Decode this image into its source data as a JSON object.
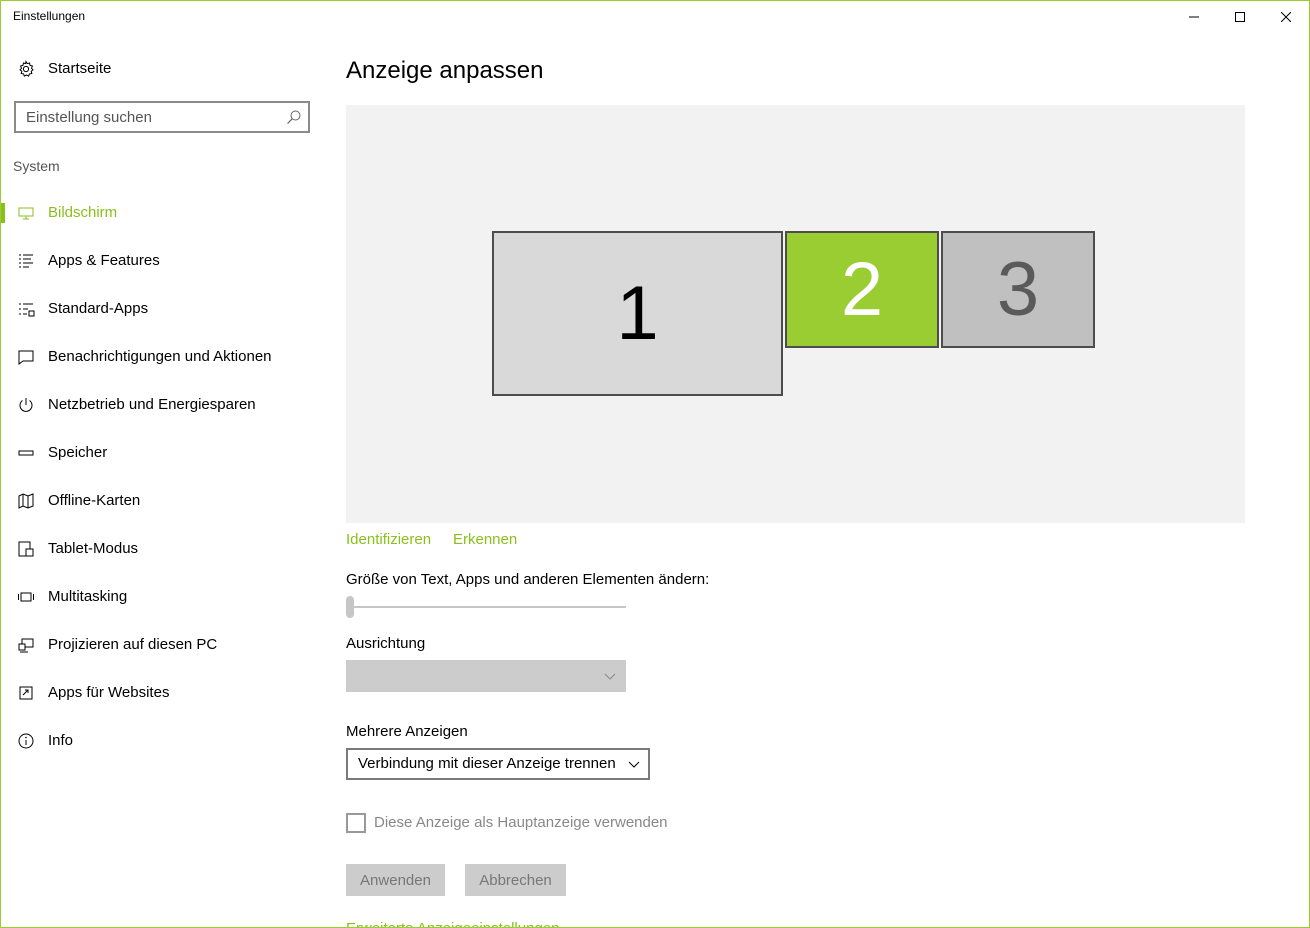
{
  "window": {
    "title": "Einstellungen"
  },
  "sidebar": {
    "home_label": "Startseite",
    "search_placeholder": "Einstellung suchen",
    "section_title": "System",
    "items": [
      {
        "label": "Bildschirm",
        "icon": "monitor-icon",
        "active": true
      },
      {
        "label": "Apps & Features",
        "icon": "list-icon",
        "active": false
      },
      {
        "label": "Standard-Apps",
        "icon": "default-apps-icon",
        "active": false
      },
      {
        "label": "Benachrichtigungen und Aktionen",
        "icon": "notification-icon",
        "active": false
      },
      {
        "label": "Netzbetrieb und Energiesparen",
        "icon": "power-icon",
        "active": false
      },
      {
        "label": "Speicher",
        "icon": "storage-icon",
        "active": false
      },
      {
        "label": "Offline-Karten",
        "icon": "map-icon",
        "active": false
      },
      {
        "label": "Tablet-Modus",
        "icon": "tablet-icon",
        "active": false
      },
      {
        "label": "Multitasking",
        "icon": "multitasking-icon",
        "active": false
      },
      {
        "label": "Projizieren auf diesen PC",
        "icon": "project-icon",
        "active": false
      },
      {
        "label": "Apps für Websites",
        "icon": "apps-websites-icon",
        "active": false
      },
      {
        "label": "Info",
        "icon": "info-icon",
        "active": false
      }
    ]
  },
  "main": {
    "title": "Anzeige anpassen",
    "monitors": [
      {
        "number": "1",
        "selected": false
      },
      {
        "number": "2",
        "selected": true
      },
      {
        "number": "3",
        "selected": false
      }
    ],
    "identify_link": "Identifizieren",
    "detect_link": "Erkennen",
    "scale_label": "Größe von Text, Apps und anderen Elementen ändern:",
    "scale_value_fraction": 0,
    "orientation_label": "Ausrichtung",
    "orientation_value": "",
    "multi_display_label": "Mehrere Anzeigen",
    "multi_display_value": "Verbindung mit dieser Anzeige trennen",
    "main_display_checkbox_label": "Diese Anzeige als Hauptanzeige verwenden",
    "main_display_checked": false,
    "apply_button": "Anwenden",
    "cancel_button": "Abbrechen",
    "advanced_link": "Erweiterte Anzeigeeinstellungen"
  },
  "colors": {
    "accent": "#8bbf1e",
    "selected_monitor": "#9acd32",
    "monitor_default": "#d9d9d9",
    "monitor_inactive": "#c0c0c0",
    "disabled_bg": "#cccccc"
  }
}
